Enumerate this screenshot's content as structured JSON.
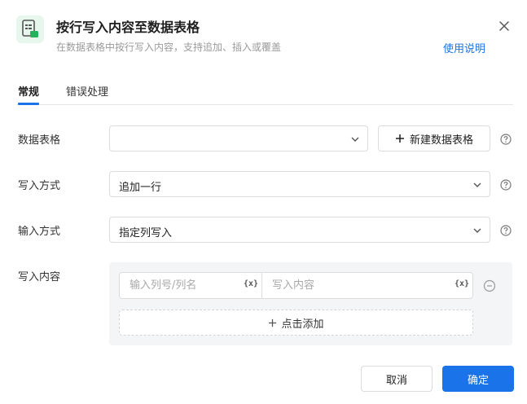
{
  "header": {
    "title": "按行写入内容至数据表格",
    "subtitle": "在数据表格中按行写入内容，支持追加、插入或覆盖",
    "help_link": "使用说明",
    "icon": "spreadsheet-icon"
  },
  "tabs": [
    {
      "label": "常规",
      "active": true
    },
    {
      "label": "错误处理",
      "active": false
    }
  ],
  "form": {
    "data_table": {
      "label": "数据表格",
      "value": "",
      "new_button": "新建数据表格"
    },
    "write_mode": {
      "label": "写入方式",
      "value": "追加一行"
    },
    "input_mode": {
      "label": "输入方式",
      "value": "指定列写入"
    },
    "content": {
      "label": "写入内容",
      "column_placeholder": "输入列号/列名",
      "value_placeholder": "写入内容",
      "var_icon_text": "{x}",
      "add_label": "点击添加"
    }
  },
  "footer": {
    "cancel_label": "取消",
    "ok_label": "确定"
  },
  "colors": {
    "accent": "#1a73e8",
    "brand_green": "#22b35e",
    "panel_bg": "#f4f5f7"
  }
}
